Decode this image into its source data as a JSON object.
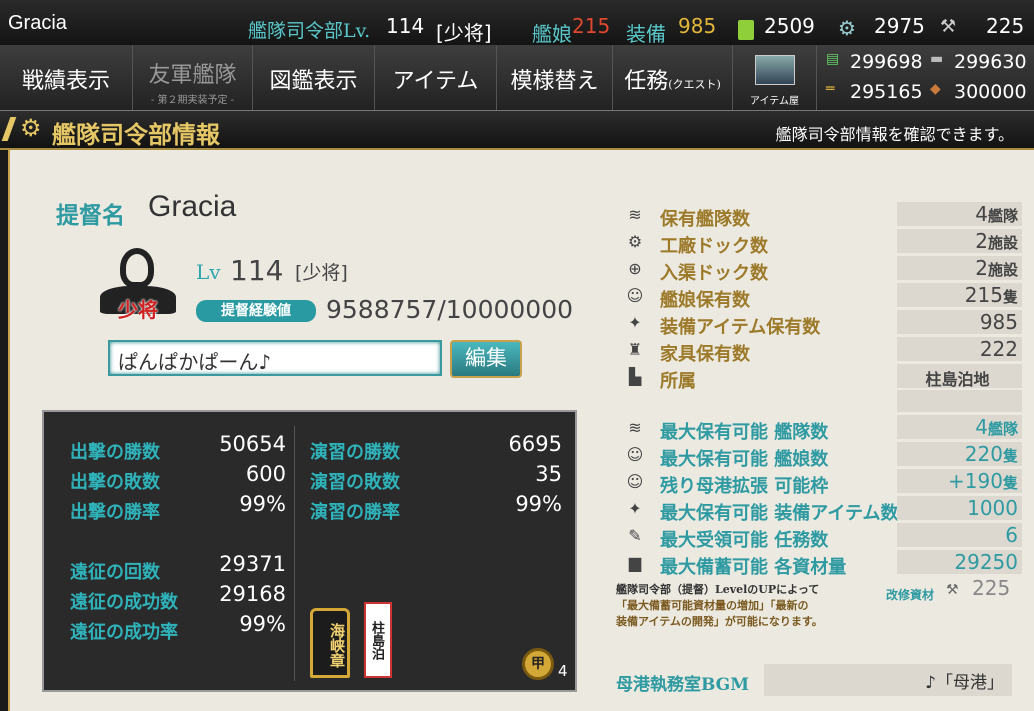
{
  "top": {
    "player": "Gracia",
    "hq_label": "艦隊司令部Lv.",
    "level": "114",
    "rank": "[少将]",
    "ships_label": "艦娘",
    "ships": "215",
    "equip_label": "装備",
    "equip": "985",
    "bucket": "2509",
    "devmat": "2975",
    "screw": "225"
  },
  "nav": {
    "tabs": [
      {
        "label": "戦績表示"
      },
      {
        "label": "友軍艦隊",
        "sub": "- 第２期実装予定 -"
      },
      {
        "label": "図鑑表示"
      },
      {
        "label": "アイテム"
      },
      {
        "label": "模様替え"
      },
      {
        "label": "任務",
        "sub2": "(クエスト)"
      }
    ],
    "shop": "アイテム屋"
  },
  "resources": {
    "fuel": "299698",
    "steel": "299630",
    "ammo": "295165",
    "bauxite": "300000"
  },
  "header": {
    "title": "艦隊司令部情報",
    "note": "艦隊司令部情報を確認できます。"
  },
  "admiral": {
    "name_label": "提督名",
    "name": "Gracia",
    "lv_label": "Lv",
    "level": "114",
    "rank": "[少将]",
    "rank_badge": "少将",
    "exp_label": "提督経験値",
    "exp": "9588757/10000000",
    "comment": "ぱんぱかぱーん♪",
    "edit": "編集"
  },
  "stats": {
    "sortie_win_l": "出撃の勝数",
    "sortie_win": "50654",
    "sortie_lose_l": "出撃の敗数",
    "sortie_lose": "600",
    "sortie_rate_l": "出撃の勝率",
    "sortie_rate": "99%",
    "ex_win_l": "演習の勝数",
    "ex_win": "6695",
    "ex_lose_l": "演習の敗数",
    "ex_lose": "35",
    "ex_rate_l": "演習の勝率",
    "ex_rate": "99%",
    "exp_count_l": "遠征の回数",
    "exp_count": "29371",
    "exp_succ_l": "遠征の成功数",
    "exp_succ": "29168",
    "exp_rate_l": "遠征の成功率",
    "exp_rate": "99%",
    "medal1": "海峡章",
    "medal2": "柱島泊",
    "medal_count": "4",
    "medal_badge": "甲"
  },
  "info": [
    {
      "label": "保有艦隊数",
      "value": "4",
      "unit": "艦隊"
    },
    {
      "label": "工廠ドック数",
      "value": "2",
      "unit": "施設"
    },
    {
      "label": "入渠ドック数",
      "value": "2",
      "unit": "施設"
    },
    {
      "label": "艦娘保有数",
      "value": "215",
      "unit": "隻"
    },
    {
      "label": "装備アイテム保有数",
      "value": "985",
      "unit": ""
    },
    {
      "label": "家具保有数",
      "value": "222",
      "unit": ""
    },
    {
      "label": "所属",
      "value": "柱島泊地",
      "unit": ""
    }
  ],
  "max": [
    {
      "label": "最大保有可能 艦隊数",
      "value": "4",
      "unit": "艦隊"
    },
    {
      "label": "最大保有可能 艦娘数",
      "value": "220",
      "unit": "隻"
    },
    {
      "label": "残り母港拡張 可能枠",
      "value": "+190",
      "unit": "隻"
    },
    {
      "label": "最大保有可能 装備アイテム数",
      "value": "1000",
      "unit": ""
    },
    {
      "label": "最大受領可能 任務数",
      "value": "6",
      "unit": ""
    },
    {
      "label": "最大備蓄可能 各資材量",
      "value": "29250",
      "unit": ""
    }
  ],
  "note": {
    "line1": "艦隊司令部（提督）LevelのUPによって",
    "line2": "「最大備蓄可能資材量の増加」「最新の",
    "line3": "装備アイテムの開発」が可能になります。",
    "kaishu_label": "改修資材",
    "kaishu": "225"
  },
  "bgm": {
    "label": "母港執務室BGM",
    "value": "♪「母港」"
  }
}
